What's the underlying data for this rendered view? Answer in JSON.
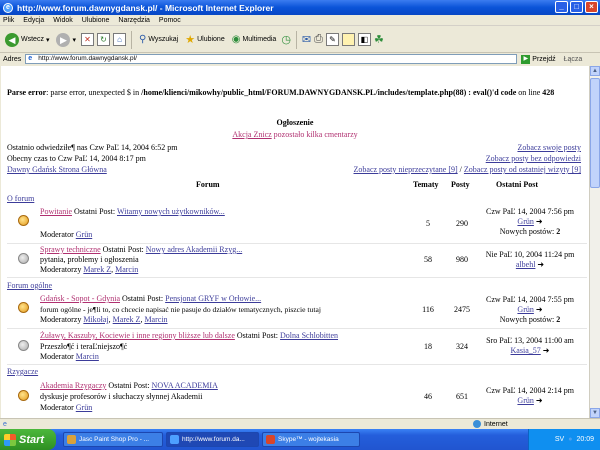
{
  "window": {
    "title": "http://www.forum.dawnygdansk.pl/ - Microsoft Internet Explorer",
    "buttons": [
      "_",
      "□",
      "×"
    ]
  },
  "menu": [
    "Plik",
    "Edycja",
    "Widok",
    "Ulubione",
    "Narzędzia",
    "Pomoc"
  ],
  "toolbar": {
    "back": "Wstecz",
    "search": "Wyszukaj",
    "favorites": "Ulubione",
    "multimedia": "Multimedia"
  },
  "address": {
    "label": "Adres",
    "url": "http://www.forum.dawnygdansk.pl/",
    "go": "Przejdź",
    "links": "Łącza"
  },
  "page": {
    "error_prefix": "Parse error",
    "error_text": ": parse error, unexpected $ in ",
    "error_path": "/home/klienci/mikowhy/public_html/FORUM.DAWNYGDANSK.PL/includes/template.php(88) : eval()'d code",
    "error_line_prefix": " on line ",
    "error_line": "428",
    "announcement_title": "Ogłoszenie",
    "announcement_link": "Akcja Znicz",
    "announcement_rest": " pozostało kilka cmentarzy",
    "last_visit": "Ostatnio odwiedziłe¶ nas Czw PaĽ 14, 2004 6:52 pm",
    "current_time": "Obecny czas to Czw PaĽ 14, 2004 8:17 pm",
    "home_link": "Dawny Gdańsk Strona Główna",
    "own_posts": "Zobacz swoje posty",
    "unanswered": "Zobacz posty bez odpowiedzi",
    "unread": "Zobacz posty nieprzeczytane [9]",
    "slash": " / ",
    "since_last": "Zobacz posty od ostatniej wizyty [9]"
  },
  "table": {
    "headers": [
      "Forum",
      "Tematy",
      "Posty",
      "Ostatni Post"
    ],
    "categories": [
      "O forum",
      "Forum ogólne",
      "Rzygacze"
    ],
    "rows": [
      {
        "name": "Powitanie",
        "lastpost_label": "Ostatni Post:",
        "lastpost_link": "Witamy nowych użytkowników...",
        "desc": "",
        "mods_label": "Moderator",
        "mods": [
          "Grün"
        ],
        "topics": "5",
        "posts": "290",
        "last_date": "Czw PaĽ 14, 2004 7:56 pm",
        "last_user": "Grün",
        "new_label": "Nowych postów:",
        "new_count": "2",
        "icon": "forum-new-icon"
      },
      {
        "name": "Sprawy techniczne",
        "lastpost_label": "Ostatni Post:",
        "lastpost_link": "Nowy adres Akademii Rzyg...",
        "desc": "pytania, problemy i ogłoszenia",
        "mods_label": "Moderatorzy",
        "mods": [
          "Marek Z",
          "Marcin"
        ],
        "topics": "58",
        "posts": "980",
        "last_date": "Nie PaĽ 10, 2004 11:24 pm",
        "last_user": "albehl",
        "new_label": "",
        "new_count": "",
        "icon": "forum-read-icon"
      },
      {
        "name": "Gdańsk - Sopot - Gdynia",
        "lastpost_label": "Ostatni Post:",
        "lastpost_link": "Pensjonat GRYF w Orłowie...",
        "desc": "forum ogólne - je¶li to, co chcecie napisać nie pasuje do działów tematycznych, piszcie tutaj",
        "mods_label": "Moderatorzy",
        "mods": [
          "Mikołaj",
          "Marek Z",
          "Marcin"
        ],
        "topics": "116",
        "posts": "2475",
        "last_date": "Czw PaĽ 14, 2004 7:55 pm",
        "last_user": "Grün",
        "new_label": "Nowych postów:",
        "new_count": "2",
        "icon": "forum-new-icon"
      },
      {
        "name": "Żuławy, Kaszuby, Kociewie i inne regiony bliższe lub dalsze",
        "lastpost_label": "Ostatni Post:",
        "lastpost_link": "Dolna Schlobitten",
        "desc": "Przeszło¶ć i teraĽniejszo¶ć",
        "mods_label": "Moderator",
        "mods": [
          "Marcin"
        ],
        "topics": "18",
        "posts": "324",
        "last_date": "Sro PaĽ 13, 2004 11:00 am",
        "last_user": "Kasia_57",
        "new_label": "",
        "new_count": "",
        "icon": "forum-read-icon"
      },
      {
        "name": "Akademia Rzygaczy",
        "lastpost_label": "Ostatni Post:",
        "lastpost_link": "NOVA ACADEMIA",
        "desc": "dyskusje profesorów i słuchaczy słynnej Akademii",
        "mods_label": "Moderator",
        "mods": [
          "Grün"
        ],
        "topics": "46",
        "posts": "651",
        "last_date": "Czw PaĽ 14, 2004 2:14 pm",
        "last_user": "Grün",
        "new_label": "Nowych postów:",
        "new_count": "2",
        "icon": "forum-new-icon"
      }
    ]
  },
  "status": {
    "zone": "Internet"
  },
  "taskbar": {
    "start": "Start",
    "tasks": [
      "Jasc Paint Shop Pro - ...",
      "http://www.forum.da...",
      "Skype™ - wojtekasia"
    ],
    "lang": "SV",
    "clock": "20:09"
  }
}
